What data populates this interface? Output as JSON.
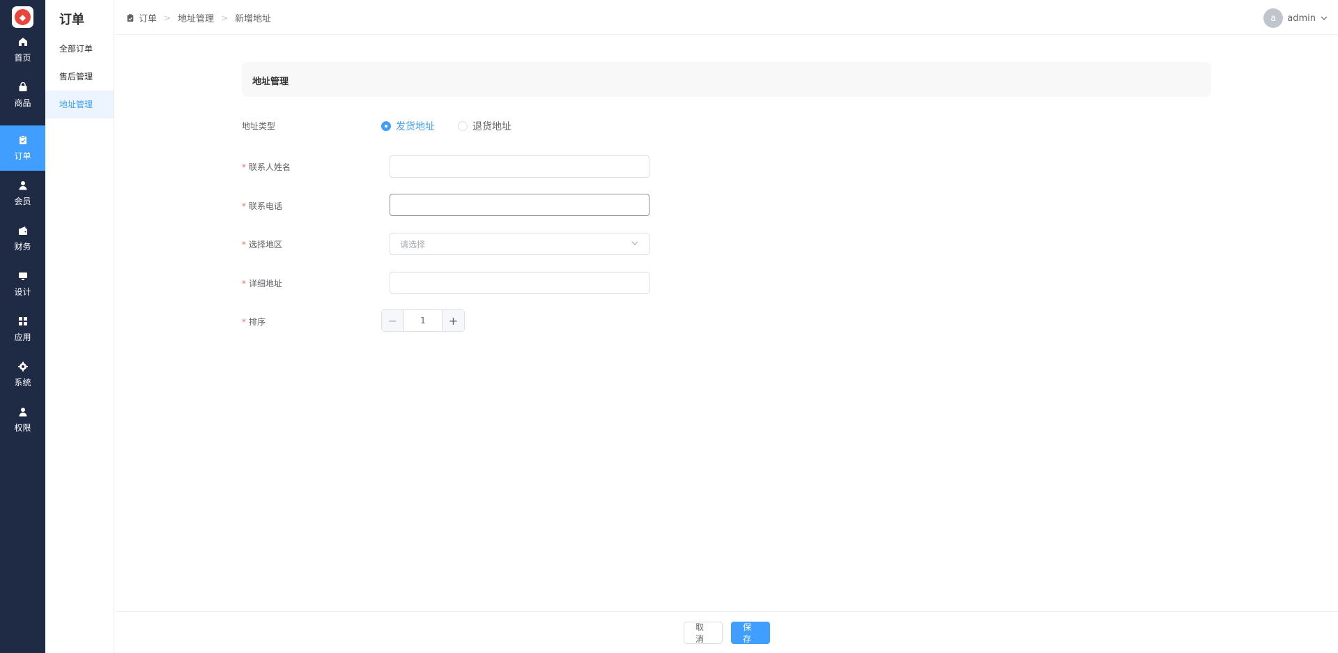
{
  "nav": {
    "items": [
      {
        "label": "首页",
        "icon": "home-icon"
      },
      {
        "label": "商品",
        "icon": "bag-icon"
      },
      {
        "label": "订单",
        "icon": "clipboard-icon",
        "active": true
      },
      {
        "label": "会员",
        "icon": "user-icon"
      },
      {
        "label": "财务",
        "icon": "wallet-icon"
      },
      {
        "label": "设计",
        "icon": "monitor-icon"
      },
      {
        "label": "应用",
        "icon": "grid-icon"
      },
      {
        "label": "系统",
        "icon": "gear-icon"
      },
      {
        "label": "权限",
        "icon": "person-icon"
      }
    ]
  },
  "submenu": {
    "title": "订单",
    "items": [
      {
        "label": "全部订单"
      },
      {
        "label": "售后管理"
      },
      {
        "label": "地址管理",
        "active": true
      }
    ]
  },
  "header": {
    "breadcrumb": [
      "订单",
      "地址管理",
      "新增地址"
    ],
    "user": {
      "avatar_letter": "a",
      "name": "admin"
    }
  },
  "section": {
    "title": "地址管理"
  },
  "form": {
    "address_type": {
      "label": "地址类型",
      "options": [
        {
          "label": "发货地址",
          "checked": true
        },
        {
          "label": "退货地址",
          "checked": false
        }
      ]
    },
    "contact_name": {
      "label": "联系人姓名",
      "value": ""
    },
    "contact_phone": {
      "label": "联系电话",
      "value": ""
    },
    "region": {
      "label": "选择地区",
      "placeholder": "请选择"
    },
    "detail_address": {
      "label": "详细地址",
      "value": ""
    },
    "sort": {
      "label": "排序",
      "value": "1",
      "minus": "−",
      "plus": "+"
    }
  },
  "footer": {
    "cancel_label": "取消",
    "save_label": "保存"
  },
  "colors": {
    "primary": "#409eff",
    "nav_bg": "#1f2a44",
    "required": "#f56c6c"
  }
}
